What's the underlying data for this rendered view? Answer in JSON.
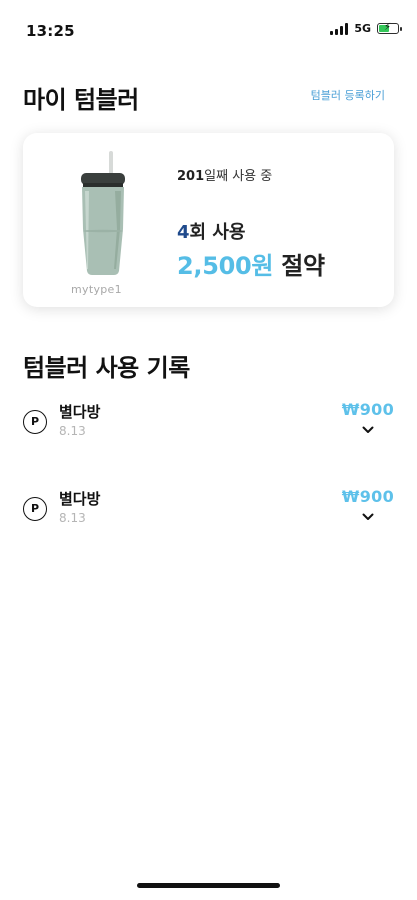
{
  "status_bar": {
    "time": "13:25",
    "network": "5G",
    "battery_level": 0.6,
    "battery_color": "#34c759"
  },
  "header": {
    "title": "마이 텀블러",
    "register_link": "텀블러 등록하기"
  },
  "tumbler_card": {
    "image_icon": "tumbler-icon",
    "name": "mytype1",
    "days": "201",
    "days_suffix": "일째 사용 중",
    "usage_count": "4",
    "usage_suffix": "회 사용",
    "saving_amount": "2,500원",
    "saving_suffix": " 절약"
  },
  "history": {
    "title": "텀블러 사용 기록",
    "items": [
      {
        "icon": "P",
        "place": "별다방",
        "date": "8.13",
        "price": "₩900"
      },
      {
        "icon": "P",
        "place": "별다방",
        "date": "8.13",
        "price": "₩900"
      }
    ]
  },
  "colors": {
    "accent": "#55bde6",
    "link": "#4a9fd6",
    "usage_number": "#1f4a8c"
  }
}
